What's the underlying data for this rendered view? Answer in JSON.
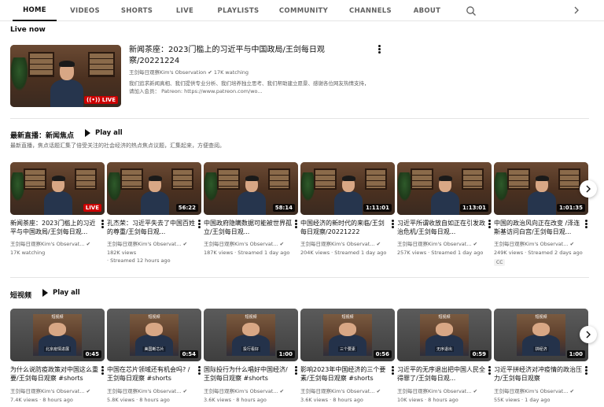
{
  "tabs": [
    "HOME",
    "VIDEOS",
    "SHORTS",
    "LIVE",
    "PLAYLISTS",
    "COMMUNITY",
    "CHANNELS",
    "ABOUT"
  ],
  "live_now": {
    "section_title": "Live now",
    "title": "新闻茶座：2023门槛上的习近平与中国政局/王剑每日观察/20221224",
    "channel": "王剑每日观察Kim's Observation",
    "watching": "17K watching",
    "desc_line1": "我们追求新闻真相、我们提供专业分析、我们培养独立思考、我们帮助建立愿景、感谢各位网友热情支持，",
    "desc_line2": "请加入会员： Patreon: https://www.patreon.com/wo...",
    "badge": "LIVE"
  },
  "news_section": {
    "title": "最新直播：新闻焦点",
    "play_all": "Play all",
    "description": "最新直播，焦点话题汇集了倍受关注的社会经济的热点焦点议题，汇集起来，方便查阅。",
    "videos": [
      {
        "title": "新闻茶座：2023门槛上的习近平与中国政局/王剑每日观...",
        "channel": "王剑每日观察Kim's Observat...",
        "stats": "17K watching",
        "stats2": "",
        "badge": "LIVE",
        "cc": ""
      },
      {
        "title": "孔杰荣：习近平失去了中国百姓的尊重/王剑每日观...",
        "channel": "王剑每日观察Kim's Observat...",
        "stats": "182K views",
        "stats2": "· Streamed 12 hours ago",
        "badge": "56:22",
        "cc": ""
      },
      {
        "title": "中国政府隐瞒数据可能被世界孤立/王剑每日观...",
        "channel": "王剑每日观察Kim's Observat...",
        "stats": "187K views · Streamed 1 day ago",
        "stats2": "",
        "badge": "58:14",
        "cc": ""
      },
      {
        "title": "中国经济的新时代的来临/王剑每日观察/20221222",
        "channel": "王剑每日观察Kim's Observat...",
        "stats": "204K views · Streamed 1 day ago",
        "stats2": "",
        "badge": "1:11:01",
        "cc": ""
      },
      {
        "title": "习近平所谓收放自如正在引发政治危机/王剑每日观...",
        "channel": "王剑每日观察Kim's Observat...",
        "stats": "257K views · Streamed 1 day ago",
        "stats2": "",
        "badge": "1:13:01",
        "cc": ""
      },
      {
        "title": "中国的政治风向正在改变 /泽连斯基访问白宫/王剑每日观...",
        "channel": "王剑每日观察Kim's Observat...",
        "stats": "249K views · Streamed 2 days ago",
        "stats2": "",
        "badge": "1:01:35",
        "cc": "CC"
      }
    ]
  },
  "shorts_section": {
    "title": "短视频",
    "play_all": "Play all",
    "videos": [
      {
        "title": "为什么说防疫政策对中国这么重要/王剑每日观察 #shorts",
        "channel": "王剑每日观察Kim's Observat...",
        "stats": "7.4K views · 8 hours ago",
        "badge": "0:45",
        "tag": "短视频",
        "cap": "北京疫情进展"
      },
      {
        "title": "中国在芯片领域还有机会吗? /王剑每日观察 #shorts",
        "channel": "王剑每日观察Kim's Observat...",
        "stats": "5.8K views · 8 hours ago",
        "badge": "0:54",
        "tag": "短视频",
        "cap": "美国断芯片"
      },
      {
        "title": "国际投行为什么唱好中国经济/王剑每日观察 #shorts",
        "channel": "王剑每日观察Kim's Observat...",
        "stats": "3.6K views · 8 hours ago",
        "badge": "1:00",
        "tag": "短视频",
        "cap": "投行看好"
      },
      {
        "title": "影响2023年中国经济的三个要素/王剑每日观察 #shorts",
        "channel": "王剑每日观察Kim's Observat...",
        "stats": "3.6K views · 8 hours ago",
        "badge": "0:56",
        "tag": "短视频",
        "cap": "三个要素"
      },
      {
        "title": "习近平的无序退出把中国人民全得罪了/王剑每日观...",
        "channel": "王剑每日观察Kim's Observat...",
        "stats": "10K views · 8 hours ago",
        "badge": "0:59",
        "tag": "短视频",
        "cap": "无序退出"
      },
      {
        "title": "习近平拼经济对冲疫情的政治压力/王剑每日观察",
        "channel": "王剑每日观察Kim's Observat...",
        "stats": "55K views · 1 day ago",
        "badge": "1:00",
        "tag": "短视频",
        "cap": "拼经济"
      }
    ]
  },
  "colors": {
    "live_red": "#cc0000",
    "text": "#0f0f0f",
    "meta": "#606060"
  }
}
